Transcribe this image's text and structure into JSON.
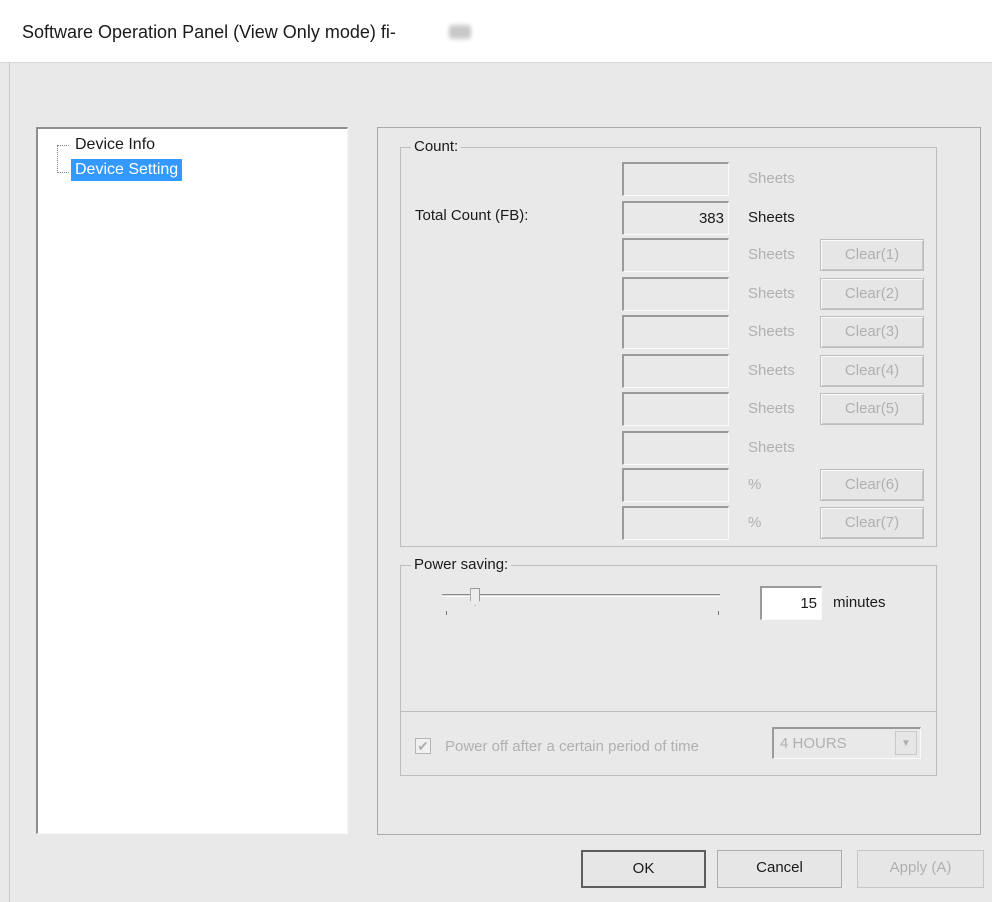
{
  "window": {
    "title": "Software Operation Panel (View Only mode) fi-"
  },
  "tree": {
    "items": [
      {
        "label": "Device Info",
        "selected": false
      },
      {
        "label": "Device Setting",
        "selected": true
      }
    ]
  },
  "count_group": {
    "label": "Count:",
    "total_label": "Total Count (FB):",
    "rows": [
      {
        "value": "",
        "unit": "Sheets",
        "clear": ""
      },
      {
        "value": "383",
        "unit": "Sheets",
        "clear": ""
      },
      {
        "value": "",
        "unit": "Sheets",
        "clear": "Clear(1)"
      },
      {
        "value": "",
        "unit": "Sheets",
        "clear": "Clear(2)"
      },
      {
        "value": "",
        "unit": "Sheets",
        "clear": "Clear(3)"
      },
      {
        "value": "",
        "unit": "Sheets",
        "clear": "Clear(4)"
      },
      {
        "value": "",
        "unit": "Sheets",
        "clear": "Clear(5)"
      },
      {
        "value": "",
        "unit": "Sheets",
        "clear": ""
      },
      {
        "value": "",
        "unit": "%",
        "clear": "Clear(6)"
      },
      {
        "value": "",
        "unit": "%",
        "clear": "Clear(7)"
      }
    ]
  },
  "power_group": {
    "label": "Power saving:",
    "minutes_value": "15",
    "minutes_unit": "minutes",
    "slider_level": 0.1,
    "poweroff_label": "Power off after a certain period of time",
    "poweroff_checked": true,
    "hours_value": "4 HOURS"
  },
  "buttons": {
    "ok": "OK",
    "cancel": "Cancel",
    "apply": "Apply (A)"
  },
  "icons": {
    "check": "check-icon",
    "dropdown": "chevron-down-icon"
  },
  "colors": {
    "selection": "#3399ff",
    "disabled_text": "#b0b0b0",
    "background": "#e9e9e9"
  }
}
